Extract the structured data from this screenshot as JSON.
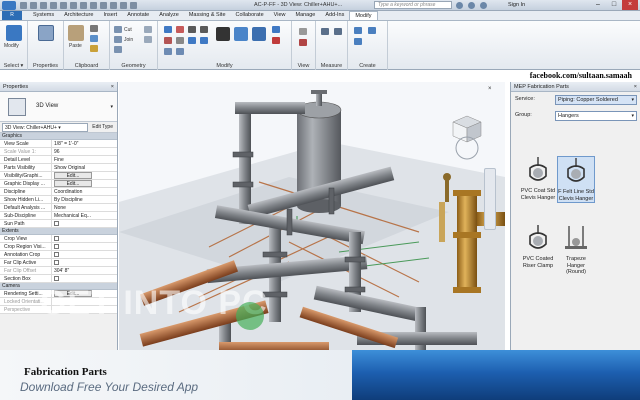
{
  "window": {
    "title": "AC-P-FF - 3D View: Chiller+AHU+...",
    "search_placeholder": "Type a keyword or phrase",
    "signin_label": "Sign In",
    "min_label": "–",
    "max_label": "□",
    "close_label": "×"
  },
  "ribbon_tabs": {
    "app_button": "R",
    "items": [
      "Systems",
      "Architecture",
      "Insert",
      "Annotate",
      "Analyze",
      "Massing & Site",
      "Collaborate",
      "View",
      "Manage",
      "Add-Ins",
      "Modify"
    ],
    "active": "Modify"
  },
  "ribbon": {
    "groups": {
      "select": "Select ▾",
      "properties": "Properties",
      "clipboard": "Clipboard",
      "geometry": "Geometry",
      "modify": "Modify",
      "view": "View",
      "measure": "Measure",
      "create": "Create"
    },
    "modify_button_label": "Modify",
    "paste_label": "Paste",
    "cut_label": "Cut",
    "join_label": "Join"
  },
  "properties_panel": {
    "title": "Properties",
    "close_label": "×",
    "type_name": "3D View",
    "type_caret": "▾",
    "instance_dropdown": "3D View: Chiller+AHU+ ▾",
    "edit_type_label": "Edit Type",
    "sections": {
      "graphics": "Graphics",
      "extents": "Extents",
      "camera": "Camera"
    },
    "graphics_rows": [
      {
        "key": "View Scale",
        "value": "1/8\" = 1'-0\"",
        "grey": false,
        "button": false
      },
      {
        "key": "Scale Value  1:",
        "value": "96",
        "grey": true,
        "button": false
      },
      {
        "key": "Detail Level",
        "value": "Fine",
        "grey": false,
        "button": false
      },
      {
        "key": "Parts Visibility",
        "value": "Show Original",
        "grey": false,
        "button": false
      },
      {
        "key": "Visibility/Graphi...",
        "value": "Edit...",
        "grey": false,
        "button": true
      },
      {
        "key": "Graphic Display ...",
        "value": "Edit...",
        "grey": false,
        "button": true
      },
      {
        "key": "Discipline",
        "value": "Coordination",
        "grey": false,
        "button": false
      },
      {
        "key": "Show Hidden Li...",
        "value": "By Discipline",
        "grey": false,
        "button": false
      },
      {
        "key": "Default Analysis ...",
        "value": "None",
        "grey": false,
        "button": false
      },
      {
        "key": "Sub-Discipline",
        "value": "Mechanical Eq...",
        "grey": false,
        "button": false
      },
      {
        "key": "Sun Path",
        "value": "",
        "grey": false,
        "button": false,
        "check": true
      }
    ],
    "extents_rows": [
      {
        "key": "Crop View",
        "check": true
      },
      {
        "key": "Crop Region Visi...",
        "check": true
      },
      {
        "key": "Annotation Crop",
        "check": true
      },
      {
        "key": "Far Clip Active",
        "check": true
      },
      {
        "key": "Far Clip Offset",
        "value": "304' 8\"",
        "grey": true
      },
      {
        "key": "Section Box",
        "check": true
      }
    ],
    "camera_rows": [
      {
        "key": "Rendering Setti...",
        "value": "Edit...",
        "button": true
      },
      {
        "key": "Locked Orientati...",
        "grey": true
      },
      {
        "key": "Perspective",
        "grey": true
      }
    ]
  },
  "viewport": {
    "close_label": "×",
    "watermark": "GET INTO PC"
  },
  "overlay": {
    "facebook": "facebook.com/sultaan.samaah"
  },
  "mep_panel": {
    "title": "MEP Fabrication Parts",
    "close_label": "×",
    "service_label": "Service:",
    "service_value": "Piping: Copper Soldered",
    "group_label": "Group:",
    "group_value": "Hangers",
    "parts": [
      {
        "label_1": "PVC Coat Std",
        "label_2": "Clevis Hanger",
        "selected": false
      },
      {
        "label_1": "F Felt Line Std",
        "label_2": "Clevis Hanger",
        "selected": true
      },
      {
        "label_1": "PVC Coated",
        "label_2": "Riser Clamp",
        "selected": false
      },
      {
        "label_1": "Trapeze Hanger",
        "label_2": "(Round)",
        "selected": false
      }
    ]
  },
  "banner": {
    "title": "Fabrication Parts",
    "subtitle": "Download Free Your Desired App"
  },
  "colors": {
    "accent": "#2d6db5",
    "close": "#c43c3c",
    "banner_blue": "#1d5fb0",
    "pipe_grey": "#7a7d82",
    "pipe_copper": "#b06a3e",
    "brass": "#c79535"
  }
}
